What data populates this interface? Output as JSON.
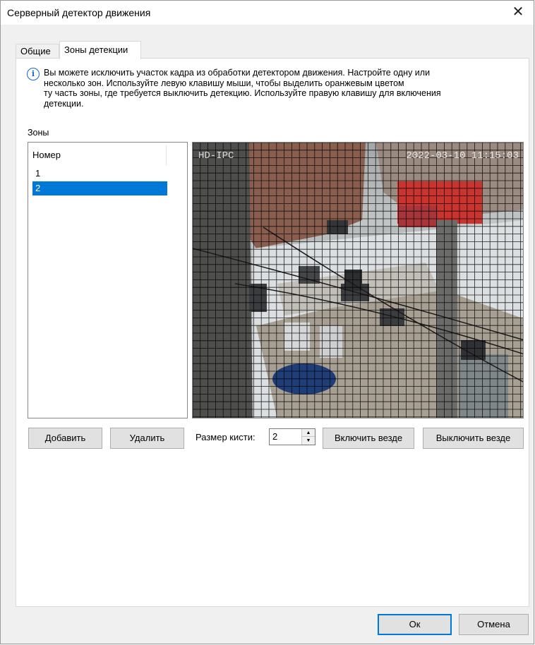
{
  "window": {
    "title": "Серверный детектор движения",
    "close_glyph": "✕"
  },
  "tabs": [
    {
      "label": "Общие",
      "active": false
    },
    {
      "label": "Зоны детекции",
      "active": true
    }
  ],
  "info": {
    "icon": "info-icon",
    "lines": [
      "Вы можете исключить участок кадра из обработки детектором движения. Настройте одну или",
      "несколько зон. Используйте левую клавишу мыши, чтобы выделить оранжевым цветом",
      "ту часть зоны, где требуется выключить детекцию. Используйте правую клавишу для включения",
      "детекции."
    ]
  },
  "zones": {
    "label": "Зоны",
    "column_header": "Номер",
    "items": [
      {
        "label": "1",
        "selected": false
      },
      {
        "label": "2",
        "selected": true
      }
    ]
  },
  "video": {
    "overlay_left": "HD-IPC",
    "overlay_right": "2022-03-10 11:15:03"
  },
  "controls": {
    "add_label": "Добавить",
    "delete_label": "Удалить",
    "brush_label": "Размер кисти:",
    "brush_value": "2",
    "enable_all_label": "Включить везде",
    "disable_all_label": "Выключить везде"
  },
  "footer": {
    "ok_label": "Ок",
    "cancel_label": "Отмена"
  },
  "colors": {
    "selection": "#0078d7",
    "grid": "#000000",
    "primary_border": "#0078d7"
  }
}
